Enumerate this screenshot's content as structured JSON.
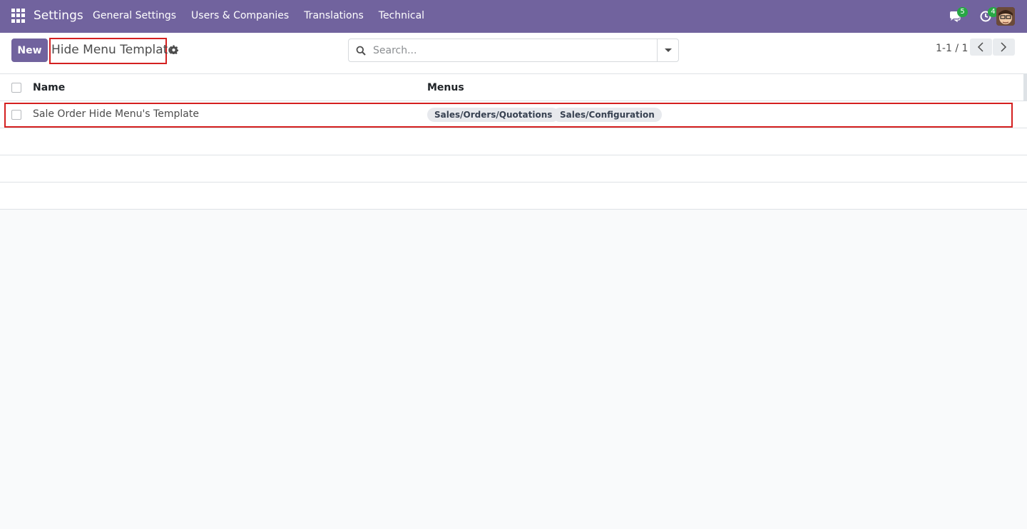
{
  "navbar": {
    "brand": "Settings",
    "menu": [
      "General Settings",
      "Users & Companies",
      "Translations",
      "Technical"
    ],
    "messages_count": "5",
    "activities_count": "4",
    "bg_color": "#71639e"
  },
  "control_panel": {
    "new_label": "New",
    "title": "Hide Menu Template",
    "search_placeholder": "Search...",
    "pager": "1-1 / 1"
  },
  "list": {
    "columns": [
      "Name",
      "Menus"
    ],
    "rows": [
      {
        "name": "Sale Order Hide Menu's Template",
        "menus": [
          "Sales/Orders/Quotations",
          "Sales/Configuration"
        ]
      }
    ]
  },
  "icons": {
    "apps": "apps-grid-icon",
    "messages": "chat-icon",
    "activities": "clock-icon",
    "gear": "gear-icon",
    "search": "search-icon",
    "prev": "chevron-left-icon",
    "next": "chevron-right-icon"
  }
}
